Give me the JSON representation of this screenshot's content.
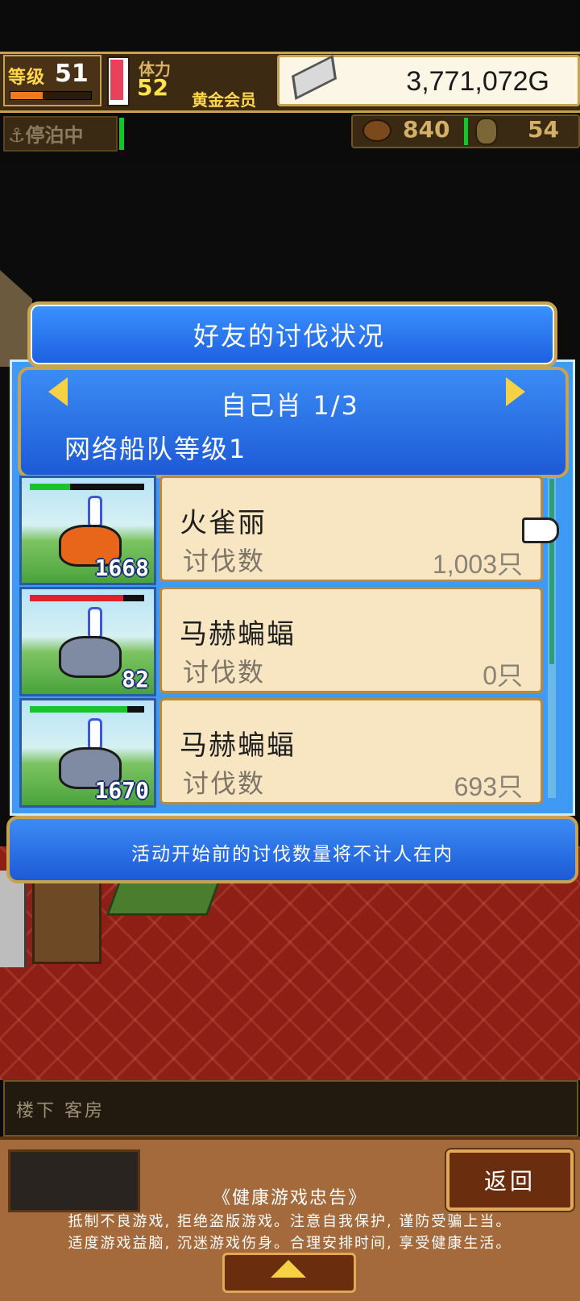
{
  "status": {
    "level_label": "等级",
    "level": "51",
    "level_progress_fraction": 0.4,
    "stamina_label": "体力",
    "stamina": "52",
    "membership": "黄金会员",
    "gold": "3,771,072G",
    "dock_status": "停泊中",
    "food": "840",
    "wood": "54"
  },
  "dialog": {
    "title": "好友的讨伐状况",
    "page_label": "自己肖 1/3",
    "fleet_level": "网络船队等级1",
    "rows": [
      {
        "name": "火雀丽",
        "kill_label": "讨伐数",
        "kill_value": "1,003只",
        "thumb_number": "1668",
        "hp_color": "#19c42a",
        "hp_fraction": 0.35,
        "monster": "fire-bird",
        "monster_color": "#e8661a"
      },
      {
        "name": "马赫蝙蝠",
        "kill_label": "讨伐数",
        "kill_value": "0只",
        "thumb_number": "82",
        "hp_color": "#e0202a",
        "hp_fraction": 0.82,
        "monster": "bat",
        "monster_color": "#7f8aa3"
      },
      {
        "name": "马赫蝙蝠",
        "kill_label": "讨伐数",
        "kill_value": "693只",
        "thumb_number": "1670",
        "hp_color": "#19c42a",
        "hp_fraction": 0.85,
        "monster": "bat",
        "monster_color": "#7f8aa3"
      }
    ],
    "notice": "活动开始前的讨伐数量将不计人在内"
  },
  "location": "楼下 客房",
  "footer": {
    "back_label": "返回",
    "advisory_title": "《健康游戏忠告》",
    "advisory_line1": "抵制不良游戏, 拒绝盗版游戏。注意自我保护, 谨防受骗上当。",
    "advisory_line2": "适度游戏益脑, 沉迷游戏伤身。合理安排时间, 享受健康生活。"
  },
  "colors": {
    "dialog_blue": "#2f7ef0",
    "gold_border": "#c9a24f",
    "card_bg": "#f8e6c2",
    "floor_red": "#8e1f17"
  }
}
